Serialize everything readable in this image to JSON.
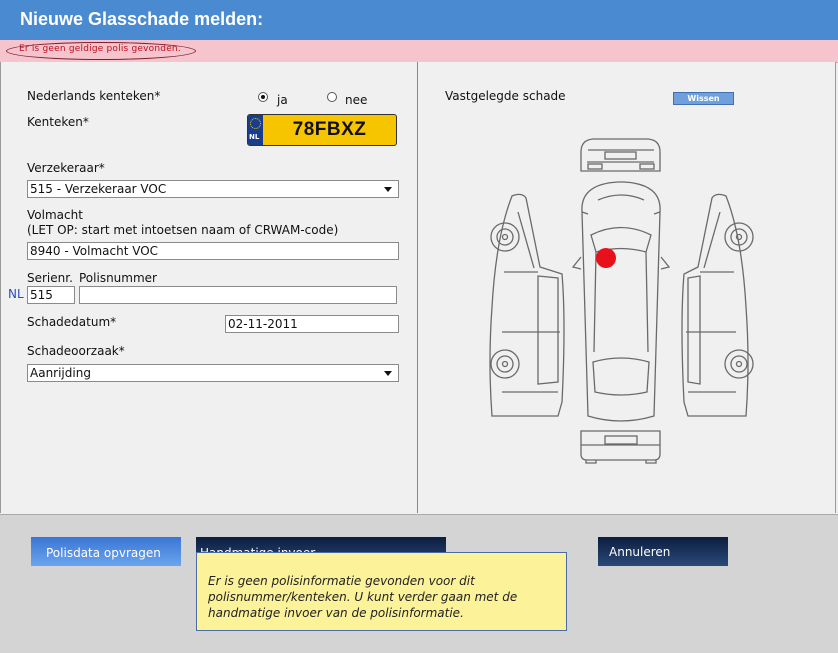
{
  "title": "Nieuwe Glasschade melden:",
  "error": "Er is geen geldige polis gevonden.",
  "form": {
    "nl_kenteken_label": "Nederlands kenteken*",
    "radio_ja": "ja",
    "radio_nee": "nee",
    "kenteken_label": "Kenteken*",
    "plate_country": "NL",
    "plate_number": "78FBXZ",
    "verzekeraar_label": "Verzekeraar*",
    "verzekeraar_value": "515 - Verzekeraar VOC",
    "volmacht_label": "Volmacht",
    "volmacht_hint": "(LET OP: start met intoetsen naam of CRWAM-code)",
    "volmacht_value": "8940 - Volmacht VOC",
    "serienr_label": "Serienr.",
    "polisnummer_label": "Polisnummer",
    "nl_prefix": "NL",
    "serienr_value": "515",
    "polisnummer_value": "",
    "schadedatum_label": "Schadedatum*",
    "schadedatum_value": "02-11-2011",
    "schadeoorzaak_label": "Schadeoorzaak*",
    "schadeoorzaak_value": "Aanrijding"
  },
  "damage": {
    "label": "Vastgelegde schade",
    "clear_button": "Wissen",
    "marker_color": "#e8101a"
  },
  "footer": {
    "polisdata_button": "Polisdata opvragen",
    "handmatige_button": "Handmatige invoer",
    "annuleren_button": "Annuleren",
    "notice": "Er is geen polisinformatie gevonden voor dit polisnummer/kenteken. U kunt verder gaan met de handmatige invoer van de polisinformatie."
  },
  "colors": {
    "title_bar": "#4a8ad0",
    "error_bar": "#f5c4cc",
    "plate_yellow": "#f7c400",
    "notice_yellow": "#fcf29a",
    "dark_button": "#0c1d3e"
  }
}
